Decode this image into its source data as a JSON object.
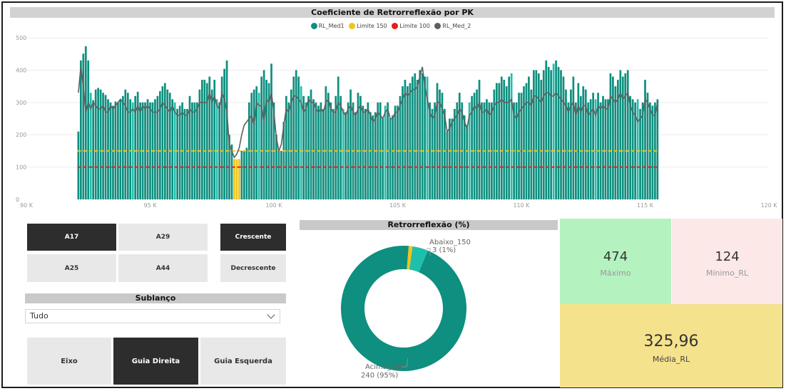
{
  "line_chart": {
    "title": "Coeficiente de Retrorreflexão por PK",
    "legend": [
      {
        "label": "RL_Med1",
        "color": "#0e8f7f"
      },
      {
        "label": "Limite 150",
        "color": "#f0c419"
      },
      {
        "label": "Limite 100",
        "color": "#e81c1c"
      },
      {
        "label": "RL_Med_2",
        "color": "#5f5f5f"
      }
    ]
  },
  "chart_data": {
    "type": "bar",
    "title": "Coeficiente de Retrorreflexão por PK",
    "x_ticks": [
      "90 K",
      "95 K",
      "100 K",
      "105 K",
      "110 K",
      "115 K",
      "120 K"
    ],
    "x_tick_values": [
      90,
      95,
      100,
      105,
      110,
      115,
      120
    ],
    "xlim": [
      90,
      120
    ],
    "y_ticks": [
      "0",
      "100",
      "200",
      "300",
      "400",
      "500"
    ],
    "y_tick_values": [
      0,
      100,
      200,
      300,
      400,
      500
    ],
    "ylim": [
      0,
      520
    ],
    "grid": true,
    "legend_position": "top-center",
    "x_start": 92.1,
    "x_step": 0.1,
    "series": [
      {
        "name": "RL_Med1",
        "type": "bar",
        "color": "#0e8f7f",
        "values": [
          210,
          430,
          451,
          474,
          430,
          330,
          307,
          340,
          345,
          340,
          330,
          323,
          310,
          300,
          290,
          303,
          300,
          307,
          320,
          340,
          330,
          310,
          300,
          320,
          333,
          300,
          300,
          300,
          310,
          300,
          300,
          310,
          320,
          335,
          350,
          360,
          340,
          330,
          310,
          300,
          280,
          290,
          300,
          280,
          280,
          320,
          300,
          300,
          300,
          340,
          370,
          370,
          360,
          380,
          340,
          370,
          310,
          300,
          380,
          404,
          430,
          200,
          170,
          125,
          124,
          125,
          150,
          150,
          160,
          300,
          330,
          340,
          350,
          330,
          380,
          400,
          370,
          360,
          420,
          300,
          200,
          150,
          150,
          240,
          320,
          300,
          340,
          380,
          400,
          380,
          350,
          320,
          300,
          320,
          340,
          310,
          300,
          290,
          300,
          280,
          350,
          330,
          300,
          280,
          320,
          380,
          320,
          280,
          270,
          300,
          340,
          300,
          270,
          330,
          320,
          290,
          280,
          300,
          270,
          260,
          270,
          300,
          300,
          250,
          290,
          300,
          250,
          260,
          290,
          290,
          320,
          350,
          370,
          350,
          360,
          380,
          390,
          370,
          400,
          390,
          380,
          380,
          300,
          280,
          300,
          360,
          340,
          330,
          280,
          210,
          250,
          250,
          280,
          300,
          330,
          300,
          260,
          230,
          300,
          320,
          330,
          340,
          370,
          300,
          300,
          310,
          300,
          300,
          340,
          360,
          360,
          380,
          370,
          350,
          380,
          390,
          300,
          300,
          330,
          330,
          350,
          360,
          380,
          340,
          400,
          400,
          390,
          370,
          400,
          430,
          410,
          400,
          420,
          430,
          410,
          400,
          380,
          340,
          300,
          340,
          380,
          300,
          360,
          320,
          350,
          340,
          300,
          310,
          330,
          310,
          330,
          300,
          320,
          310,
          310,
          390,
          380,
          350,
          370,
          400,
          380,
          390,
          400,
          320,
          310,
          300,
          310,
          280,
          300,
          370,
          330,
          300,
          290,
          300,
          310
        ]
      },
      {
        "name": "Limite 150",
        "type": "line",
        "color": "#f0c419",
        "value": 150
      },
      {
        "name": "Limite 100",
        "type": "line",
        "color": "#e81c1c",
        "value": 100
      },
      {
        "name": "RL_Med_2",
        "type": "line",
        "color": "#5f5f5f",
        "values": [
          330,
          410,
          350,
          270,
          300,
          280,
          300,
          290,
          280,
          280,
          290,
          270,
          270,
          290,
          280,
          290,
          300,
          310,
          300,
          290,
          270,
          270,
          280,
          270,
          290,
          270,
          290,
          280,
          290,
          280,
          270,
          270,
          270,
          280,
          300,
          290,
          280,
          270,
          290,
          270,
          260,
          260,
          270,
          260,
          260,
          280,
          270,
          270,
          280,
          300,
          300,
          300,
          300,
          330,
          300,
          320,
          290,
          280,
          330,
          310,
          270,
          170,
          150,
          130,
          140,
          160,
          200,
          230,
          240,
          250,
          260,
          230,
          300,
          290,
          290,
          240,
          310,
          300,
          330,
          270,
          190,
          150,
          170,
          230,
          280,
          270,
          300,
          320,
          320,
          310,
          300,
          270,
          280,
          310,
          300,
          300,
          280,
          270,
          280,
          270,
          300,
          310,
          280,
          270,
          270,
          300,
          290,
          270,
          260,
          280,
          290,
          270,
          260,
          280,
          290,
          270,
          270,
          280,
          260,
          240,
          250,
          270,
          260,
          250,
          270,
          280,
          250,
          250,
          270,
          270,
          290,
          310,
          330,
          320,
          330,
          340,
          340,
          350,
          380,
          410,
          350,
          310,
          270,
          250,
          260,
          300,
          300,
          280,
          260,
          210,
          220,
          240,
          250,
          260,
          280,
          270,
          240,
          220,
          260,
          270,
          290,
          280,
          300,
          270,
          270,
          280,
          260,
          270,
          290,
          300,
          300,
          310,
          300,
          300,
          300,
          310,
          260,
          250,
          270,
          280,
          290,
          300,
          300,
          290,
          320,
          320,
          310,
          300,
          320,
          330,
          330,
          320,
          320,
          330,
          320,
          310,
          300,
          290,
          270,
          290,
          300,
          260,
          290,
          270,
          290,
          290,
          260,
          270,
          280,
          260,
          290,
          280,
          290,
          280,
          280,
          320,
          310,
          300,
          310,
          330,
          310,
          320,
          330,
          290,
          270,
          260,
          240,
          250,
          260,
          310,
          300,
          280,
          260,
          260,
          300
        ]
      }
    ]
  },
  "slicers": {
    "route": [
      "A17",
      "A29",
      "A25",
      "A44"
    ],
    "route_selected": "A17",
    "order": [
      "Crescente",
      "Decrescente"
    ],
    "order_selected": "Crescente",
    "sublanco_title": "Sublanço",
    "sublanco_value": "Tudo",
    "side": [
      "Eixo",
      "Guia Direita",
      "Guia Esquerda"
    ],
    "side_selected": "Guia Direita"
  },
  "donut": {
    "title": "Retrorreflexão (%)",
    "label_top_name": "Abaixo_150",
    "label_top_value": "3 (1%)",
    "label_bottom_name": "Acima_200",
    "label_bottom_value": "240 (95%)",
    "segments": [
      {
        "name": "Acima_200",
        "percent": 95,
        "color": "#0e8f7f"
      },
      {
        "name": "Abaixo_150",
        "percent": 1,
        "color": "#f0c419"
      },
      {
        "name": "other",
        "percent": 4,
        "color": "#1fbfae"
      }
    ]
  },
  "cards": {
    "max_value": "474",
    "max_label": "Máximo",
    "max_color": "#b4f2c0",
    "min_value": "124",
    "min_label": "Mínimo_RL",
    "min_color": "#fde8e8",
    "avg_value": "325,96",
    "avg_label": "Média_RL",
    "avg_color": "#f5e28c"
  }
}
